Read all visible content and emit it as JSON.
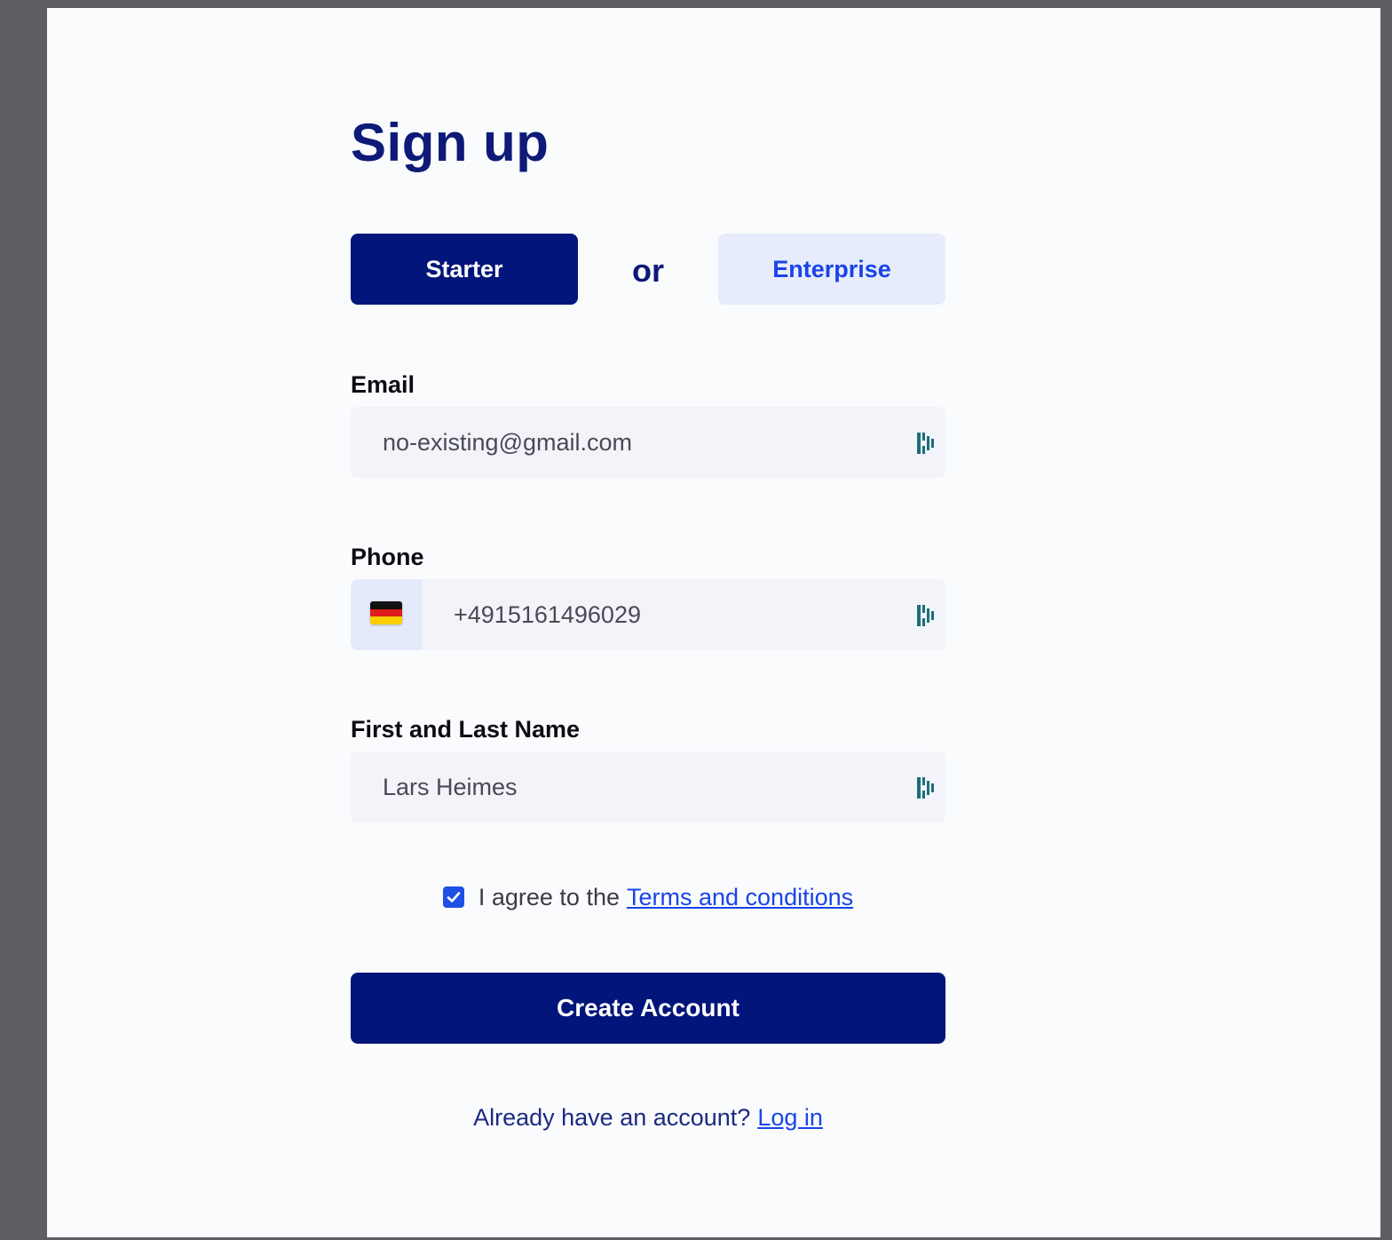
{
  "page": {
    "title": "Sign up"
  },
  "plans": {
    "starter_label": "Starter",
    "or_label": "or",
    "enterprise_label": "Enterprise",
    "selected": "Starter"
  },
  "form": {
    "email": {
      "label": "Email",
      "value": "no-existing@gmail.com"
    },
    "phone": {
      "label": "Phone",
      "country_flag": "germany-flag-icon",
      "value": "+4915161496029"
    },
    "name": {
      "label": "First and Last Name",
      "value": "Lars Heimes"
    },
    "terms": {
      "checked": true,
      "text": "I agree to the",
      "link_text": "Terms and conditions"
    },
    "submit_label": "Create Account"
  },
  "footer": {
    "text": "Already have an account?",
    "link_text": "Log in"
  },
  "icons": {
    "password_manager": "password-manager-icon",
    "checkbox": "checkmark-icon"
  },
  "colors": {
    "primary": "#02157a",
    "title": "#0d1a78",
    "link": "#1a44e8",
    "enterprise_bg": "#e6ecfb",
    "input_bg": "#f2f4f9",
    "page_bg": "#fafbfd",
    "pm_icon": "#1b6f7a"
  }
}
